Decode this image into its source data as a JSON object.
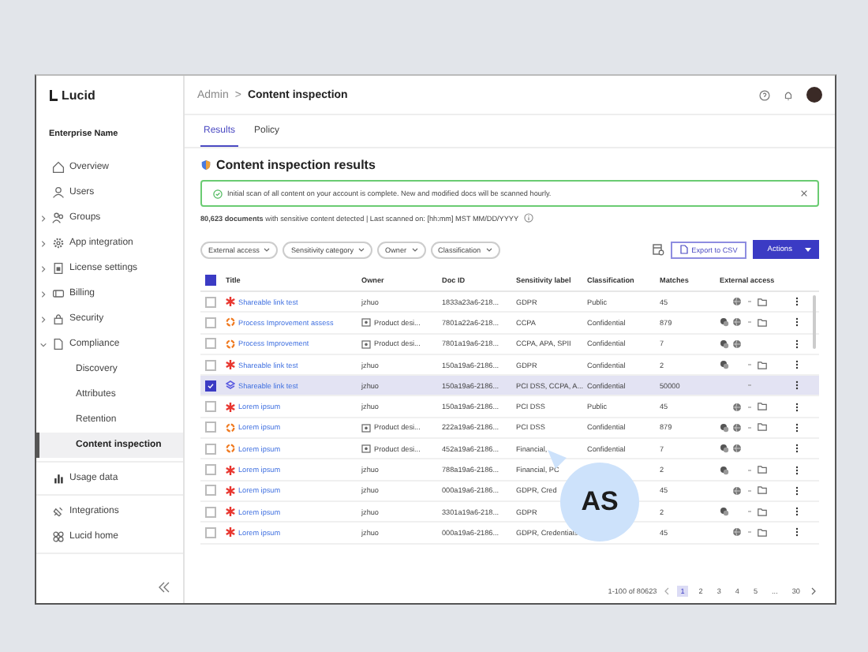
{
  "sidebar": {
    "logo": "Lucid",
    "org": "Enterprise Name",
    "sections": [
      {
        "items": [
          {
            "label": "Overview",
            "expandable": false,
            "selected": false
          },
          {
            "label": "Users",
            "expandable": false,
            "selected": false
          },
          {
            "label": "Groups",
            "expandable": true,
            "expanded": false,
            "selected": false
          },
          {
            "label": "App integration",
            "expandable": true,
            "expanded": false,
            "selected": false
          },
          {
            "label": "License settings",
            "expandable": true,
            "expanded": false,
            "selected": false
          },
          {
            "label": "Billing",
            "expandable": true,
            "expanded": false,
            "selected": false
          },
          {
            "label": "Security",
            "expandable": true,
            "expanded": false,
            "selected": false
          },
          {
            "label": "Compliance",
            "expandable": true,
            "expanded": true,
            "selected": false,
            "children": [
              {
                "label": "Discovery",
                "selected": false
              },
              {
                "label": "Attributes",
                "selected": false
              },
              {
                "label": "Retention",
                "selected": false
              },
              {
                "label": "Content inspection",
                "selected": true
              }
            ]
          }
        ]
      },
      {
        "items": [
          {
            "label": "Usage data",
            "expandable": false,
            "selected": false
          }
        ]
      },
      {
        "items": [
          {
            "label": "Integrations",
            "expandable": false,
            "selected": false
          },
          {
            "label": "Lucid home",
            "expandable": false,
            "selected": false
          }
        ]
      }
    ]
  },
  "header": {
    "breadcrumb": [
      "Admin",
      "Content inspection"
    ],
    "separator": ">"
  },
  "tabs": [
    {
      "label": "Results",
      "selected": true
    },
    {
      "label": "Policy",
      "selected": false
    }
  ],
  "title": "Content inspection results",
  "banner": {
    "text": "Initial scan of all content on your account is complete. New and modified docs will be scanned hourly."
  },
  "summary": "**80,623 documents** with sensitive content detected | Last scanned on: [hh:mm] MST MM/DD/YYYY",
  "filters": [
    "External access",
    "Sensitivity category",
    "Owner",
    "Classification"
  ],
  "export_button": "Export to CSV",
  "actions_button": "Actions",
  "table": {
    "all_checked": true,
    "columns": [
      "Title",
      "Owner",
      "Doc ID",
      "Sensitivity label",
      "Classification",
      "Matches",
      "External access"
    ],
    "rows": [
      {
        "kind": "asterisk",
        "title": "Shareable link test",
        "owner": "jzhuo",
        "owner_folder": false,
        "doc_id": "1833a23a6-218...",
        "sensitivity": "GDPR",
        "classification": "Public",
        "matches": "45",
        "access": {
          "people": false,
          "globe": true,
          "dash": true,
          "folder": true
        },
        "selected": false
      },
      {
        "kind": "ring",
        "title": "Process Improvement assess",
        "owner": "Product desi...",
        "owner_folder": true,
        "doc_id": "7801a22a6-218...",
        "sensitivity": "CCPA",
        "classification": "Confidential",
        "matches": "879",
        "access": {
          "people": true,
          "globe": true,
          "dash": true,
          "folder": true
        },
        "selected": false
      },
      {
        "kind": "ring",
        "title": "Process Improvement",
        "owner": "Product desi...",
        "owner_folder": true,
        "doc_id": "7801a19a6-218...",
        "sensitivity": "CCPA, APA, SPII",
        "classification": "Confidential",
        "matches": "7",
        "access": {
          "people": true,
          "globe": true,
          "dash": false,
          "folder": false
        },
        "selected": false
      },
      {
        "kind": "asterisk",
        "title": "Shareable link test",
        "owner": "jzhuo",
        "owner_folder": false,
        "doc_id": "150a19a6-2186...",
        "sensitivity": "GDPR",
        "classification": "Confidential",
        "matches": "2",
        "access": {
          "people": true,
          "globe": false,
          "dash": true,
          "folder": true
        },
        "selected": false
      },
      {
        "kind": "stack",
        "title": "Shareable link test",
        "owner": "jzhuo",
        "owner_folder": false,
        "doc_id": "150a19a6-2186...",
        "sensitivity": "PCI DSS, CCPA, A...",
        "classification": "Confidential",
        "matches": "50000",
        "access": {
          "people": false,
          "globe": false,
          "dash": true,
          "folder": false
        },
        "selected": true
      },
      {
        "kind": "asterisk",
        "title": "Lorem ipsum",
        "owner": "jzhuo",
        "owner_folder": false,
        "doc_id": "150a19a6-2186...",
        "sensitivity": "PCI DSS",
        "classification": "Public",
        "matches": "45",
        "access": {
          "people": false,
          "globe": true,
          "dash": true,
          "folder": true
        },
        "selected": false
      },
      {
        "kind": "ring",
        "title": "Lorem ipsum",
        "owner": "Product desi...",
        "owner_folder": true,
        "doc_id": "222a19a6-2186...",
        "sensitivity": "PCI DSS",
        "classification": "Confidential",
        "matches": "879",
        "access": {
          "people": true,
          "globe": true,
          "dash": true,
          "folder": true
        },
        "selected": false
      },
      {
        "kind": "ring",
        "title": "Lorem ipsum",
        "owner": "Product desi...",
        "owner_folder": true,
        "doc_id": "452a19a6-2186...",
        "sensitivity": "Financial,",
        "classification": "Confidential",
        "matches": "7",
        "access": {
          "people": true,
          "globe": true,
          "dash": false,
          "folder": false
        },
        "selected": false
      },
      {
        "kind": "asterisk",
        "title": "Lorem ipsum",
        "owner": "jzhuo",
        "owner_folder": false,
        "doc_id": "788a19a6-2186...",
        "sensitivity": "Financial, PC",
        "matches": "2",
        "access": {
          "people": true,
          "globe": false,
          "dash": true,
          "folder": true
        },
        "selected": false
      },
      {
        "kind": "asterisk",
        "title": "Lorem ipsum",
        "owner": "jzhuo",
        "owner_folder": false,
        "doc_id": "000a19a6-2186...",
        "sensitivity": "GDPR, Cred",
        "matches": "45",
        "access": {
          "people": false,
          "globe": true,
          "dash": true,
          "folder": true
        },
        "selected": false
      },
      {
        "kind": "asterisk",
        "title": "Lorem ipsum",
        "owner": "jzhuo",
        "owner_folder": false,
        "doc_id": "3301a19a6-218...",
        "sensitivity": "GDPR",
        "matches": "2",
        "access": {
          "people": true,
          "globe": false,
          "dash": true,
          "folder": true
        },
        "selected": false
      },
      {
        "kind": "asterisk",
        "title": "Lorem ipsum",
        "owner": "jzhuo",
        "owner_folder": false,
        "doc_id": "000a19a6-2186...",
        "sensitivity": "GDPR, Credentials",
        "matches": "45",
        "access": {
          "people": false,
          "globe": true,
          "dash": true,
          "folder": true
        },
        "selected": false
      }
    ]
  },
  "pagination": {
    "range": "1-100 of 80623",
    "pages": [
      {
        "label": "1",
        "selected": true
      },
      {
        "label": "2",
        "selected": false
      },
      {
        "label": "3",
        "selected": false
      },
      {
        "label": "4",
        "selected": false
      },
      {
        "label": "5",
        "selected": false
      },
      {
        "label": "...",
        "selected": false
      },
      {
        "label": "30",
        "selected": false
      }
    ]
  },
  "cursor": {
    "initials": "AS"
  }
}
